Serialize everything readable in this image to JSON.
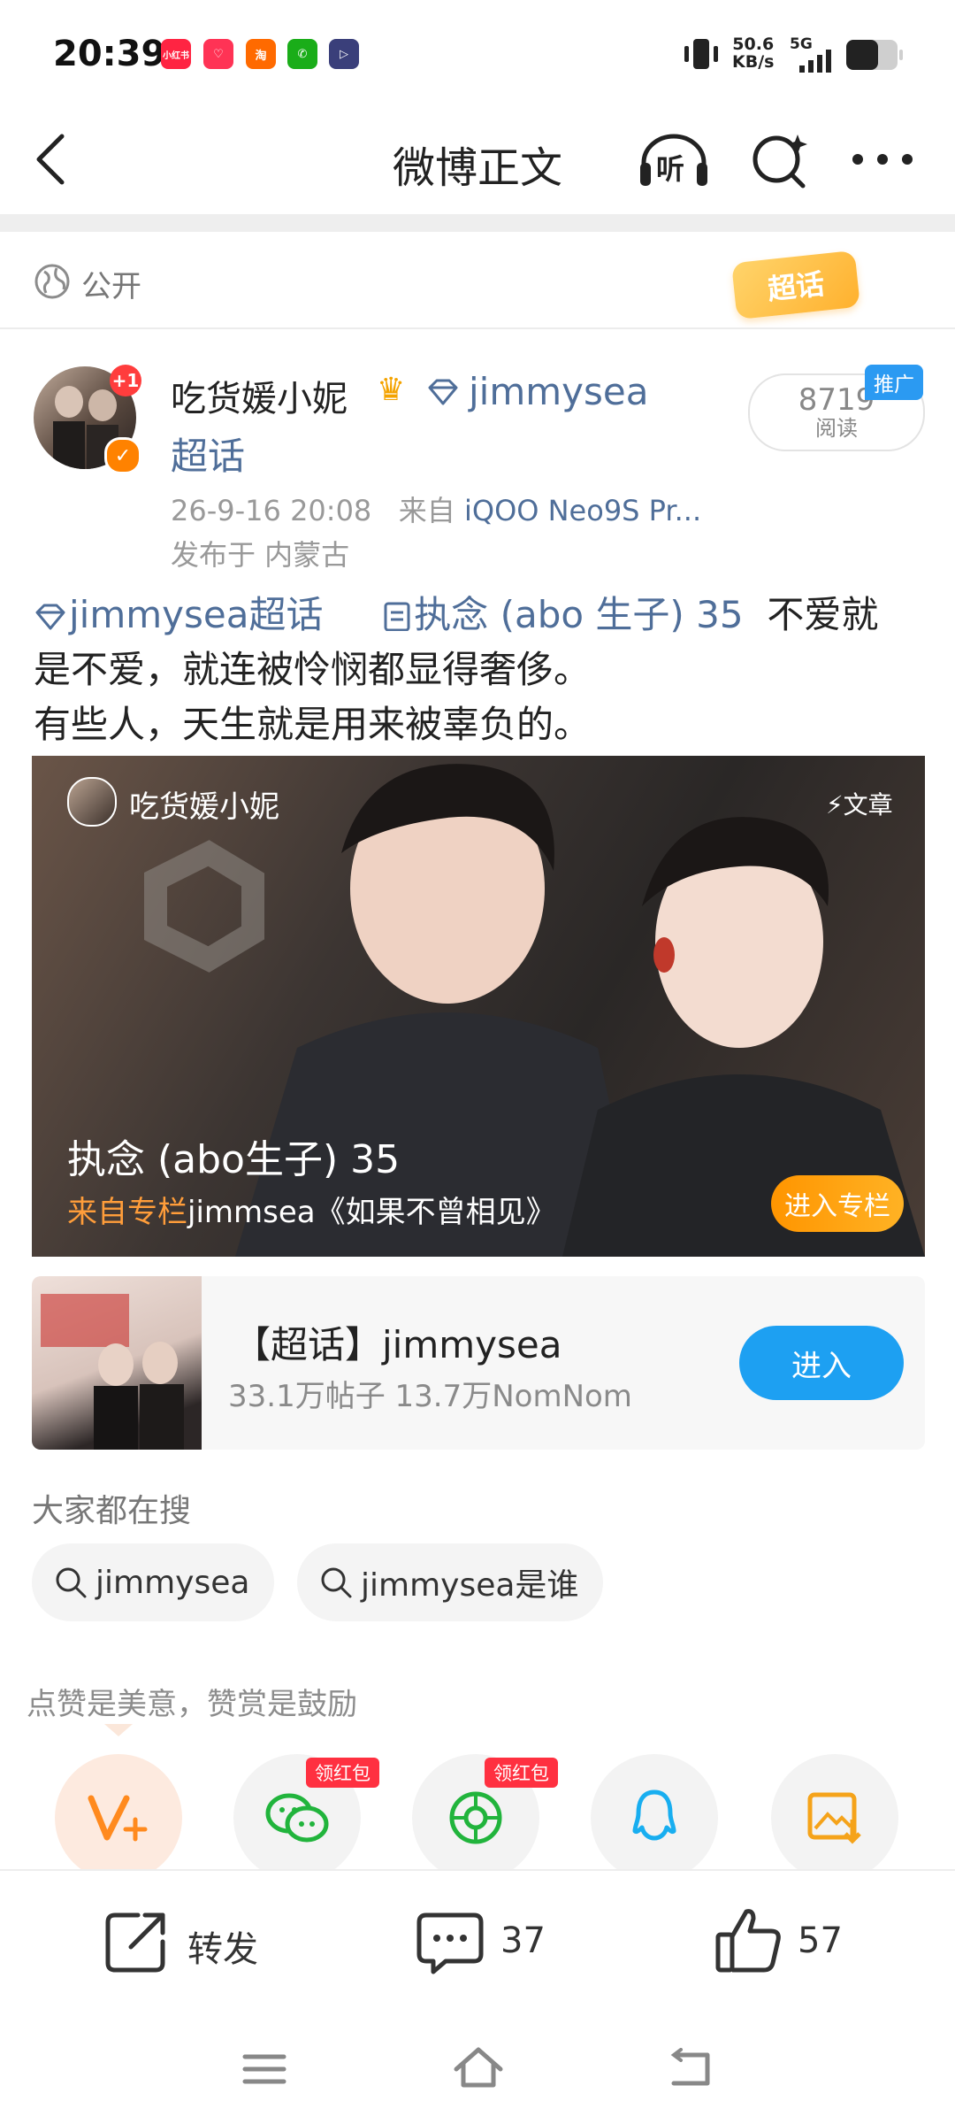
{
  "status_bar": {
    "time": "20:39",
    "apps": [
      {
        "icon": "xiaohongshu-icon",
        "label": "小红书",
        "color": "#ff2442"
      },
      {
        "icon": "heart-app-icon",
        "label": "♡",
        "color": "#ff3355"
      },
      {
        "icon": "taobao-icon",
        "label": "淘",
        "color": "#ff6a00"
      },
      {
        "icon": "wechat-icon",
        "label": "✆",
        "color": "#1aad19"
      },
      {
        "icon": "play-app-icon",
        "label": "▷",
        "color": "#3a3f7a"
      }
    ],
    "speed_value": "50.6",
    "speed_unit": "KB/s",
    "network": "5G"
  },
  "nav": {
    "title": "微博正文",
    "listen_label": "听"
  },
  "visibility": {
    "label": "公开",
    "badge": "超话"
  },
  "author": {
    "name": "吃货媛小妮",
    "avatar_badge": "+1",
    "supertopic_name": "jimmysea",
    "supertopic_suffix": "超话",
    "time": "26-9-16 20:08",
    "source_prefix": "来自",
    "source": "iQOO Neo9S Pr...",
    "location": "发布于 内蒙古"
  },
  "reads": {
    "count": "8719",
    "label": "阅读",
    "promo": "推广"
  },
  "post": {
    "topic_link": "jimmysea超话",
    "article_link": "执念 (abo 生子) 35",
    "line1": "不爱就",
    "line2": "是不爱，就连被怜悯都显得奢侈。",
    "line3": "有些人，天生就是用来被辜负的。"
  },
  "article": {
    "author": "吃货媛小妮",
    "type_label": "文章",
    "title": "执念 (abo生子) 35",
    "from_label": "来自专栏",
    "column": "jimmsea《如果不曾相见》",
    "enter_label": "进入专栏"
  },
  "supertopic_card": {
    "name": "【超话】jimmysea",
    "stats": "33.1万帖子 13.7万NomNom",
    "enter_label": "进入"
  },
  "searches": {
    "title": "大家都在搜",
    "items": [
      "jimmysea",
      "jimmysea是谁"
    ]
  },
  "tip": "点赞是美意，赞赏是鼓励",
  "share": {
    "redpacket_label": "领红包"
  },
  "actions": {
    "repost_label": "转发",
    "comment_count": "37",
    "like_count": "57"
  }
}
